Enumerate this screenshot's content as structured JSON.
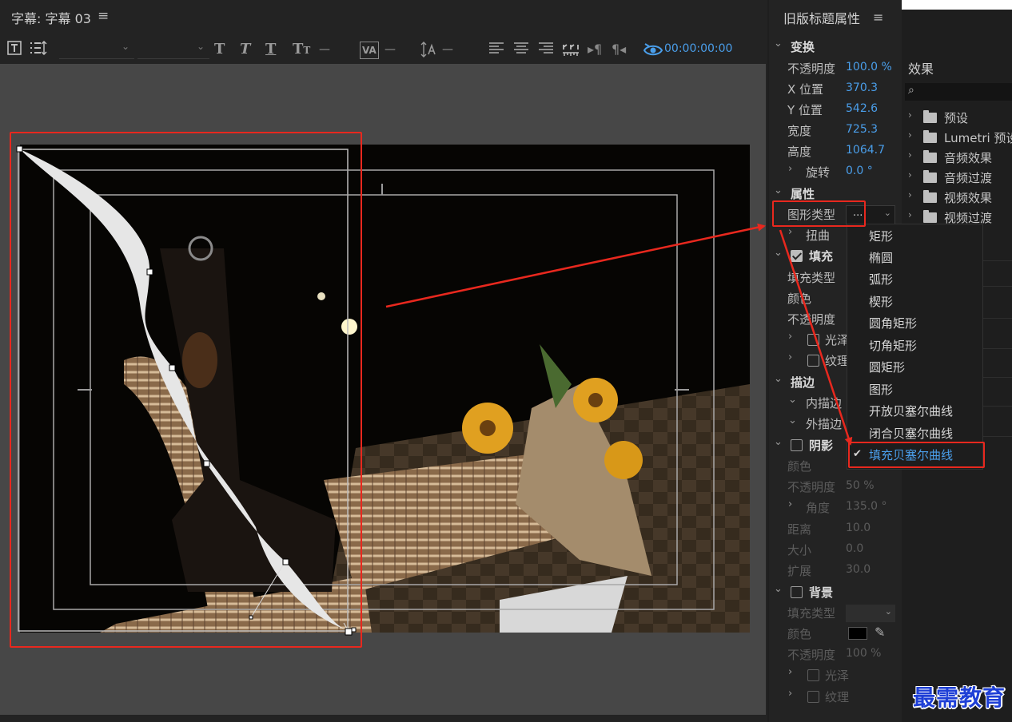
{
  "title_panel": {
    "title": "字幕: 字幕 03",
    "menu_icon": "hamburger-icon",
    "timecode": "00:00:00:00"
  },
  "toolbar": {
    "icons": [
      "text-tool-icon",
      "tab-stops-icon",
      "font-family-dropdown",
      "font-style-dropdown",
      "bold-T-icon",
      "italic-T-icon",
      "underline-T-icon",
      "font-size-icon",
      "kerning-icon",
      "leading-icon",
      "align-left-icon",
      "align-center-icon",
      "align-right-icon",
      "tab-ruler-icon",
      "roll-crawl-icon",
      "paragraph-icon",
      "show-video-icon"
    ],
    "dash": "—"
  },
  "properties": {
    "title": "旧版标题属性",
    "transform": {
      "header": "变换",
      "rows": [
        {
          "label": "不透明度",
          "value": "100.0 %"
        },
        {
          "label": "X 位置",
          "value": "370.3"
        },
        {
          "label": "Y 位置",
          "value": "542.6"
        },
        {
          "label": "宽度",
          "value": "725.3"
        },
        {
          "label": "高度",
          "value": "1064.7"
        }
      ],
      "rotation": {
        "label": "旋转",
        "value": "0.0 °"
      }
    },
    "attributes": {
      "header": "属性",
      "shape_type_label": "图形类型",
      "shape_type_value": "...",
      "distort_label": "扭曲"
    },
    "fill": {
      "header": "填充",
      "checked": true,
      "rows": [
        "填充类型",
        "颜色",
        "不透明度"
      ],
      "sheen": "光泽",
      "texture": "纹理"
    },
    "stroke": {
      "header": "描边",
      "inner": "内描边",
      "outer": "外描边"
    },
    "shadow": {
      "header": "阴影",
      "checked": false,
      "rows": [
        {
          "label": "颜色",
          "value": ""
        },
        {
          "label": "不透明度",
          "value": "50 %"
        },
        {
          "label": "角度",
          "value": "135.0 °"
        },
        {
          "label": "距离",
          "value": "10.0"
        },
        {
          "label": "大小",
          "value": "0.0"
        },
        {
          "label": "扩展",
          "value": "30.0"
        }
      ]
    },
    "background": {
      "header": "背景",
      "checked": false,
      "fill_type": "填充类型",
      "color": "颜色",
      "opacity": "不透明度",
      "opacity_value": "100 %",
      "sheen": "光泽",
      "texture": "纹理"
    }
  },
  "shape_type_options": [
    {
      "label": "矩形",
      "selected": false
    },
    {
      "label": "椭圆",
      "selected": false
    },
    {
      "label": "弧形",
      "selected": false
    },
    {
      "label": "楔形",
      "selected": false
    },
    {
      "label": "圆角矩形",
      "selected": false
    },
    {
      "label": "切角矩形",
      "selected": false
    },
    {
      "label": "圆矩形",
      "selected": false
    },
    {
      "label": "图形",
      "selected": false
    },
    {
      "label": "开放贝塞尔曲线",
      "selected": false
    },
    {
      "label": "闭合贝塞尔曲线",
      "selected": false
    },
    {
      "label": "填充贝塞尔曲线",
      "selected": true
    }
  ],
  "effects": {
    "title": "效果",
    "items": [
      "预设",
      "Lumetri 预设",
      "音频效果",
      "音频过渡",
      "视频效果",
      "视频过渡"
    ]
  },
  "watermark": "最需教育",
  "colors": {
    "accent_blue": "#4a9eea",
    "annotation_red": "#e8281e",
    "watermark_blue": "#1e3fd6"
  }
}
